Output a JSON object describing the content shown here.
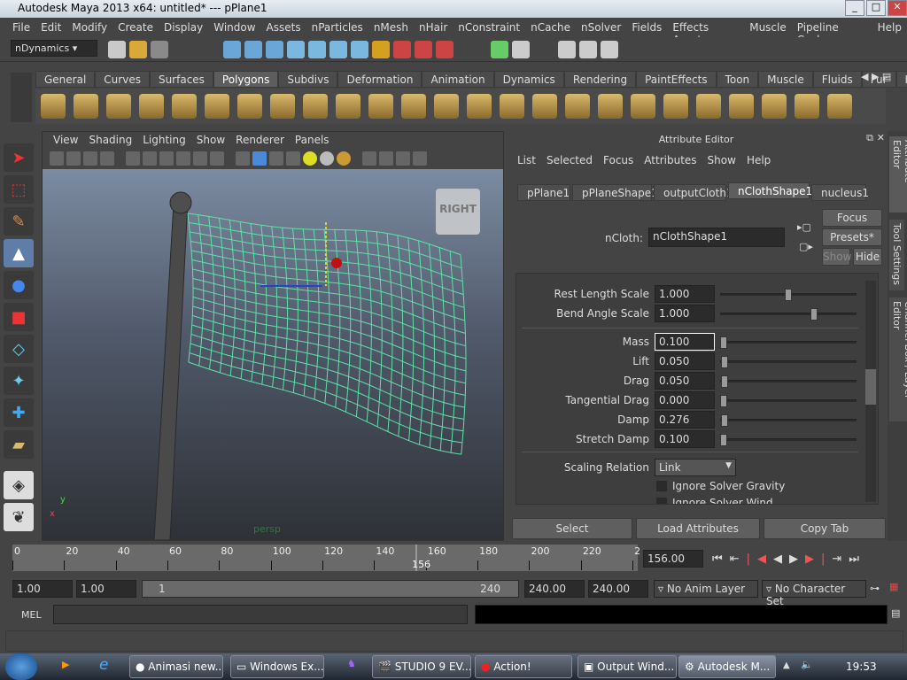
{
  "title": "Autodesk Maya 2013 x64: untitled*   ---   pPlane1",
  "menu": [
    "File",
    "Edit",
    "Modify",
    "Create",
    "Display",
    "Window",
    "Assets",
    "nParticles",
    "nMesh",
    "nHair",
    "nConstraint",
    "nCache",
    "nSolver",
    "Fields",
    "Effects Assets",
    "Muscle",
    "Pipeline Cache",
    "Help"
  ],
  "menuset": "nDynamics",
  "shelf_tabs": [
    "General",
    "Curves",
    "Surfaces",
    "Polygons",
    "Subdivs",
    "Deformation",
    "Animation",
    "Dynamics",
    "Rendering",
    "PaintEffects",
    "Toon",
    "Muscle",
    "Fluids",
    "Fur",
    "Hair"
  ],
  "shelf_active": "Polygons",
  "viewport": {
    "menu": [
      "View",
      "Shading",
      "Lighting",
      "Show",
      "Renderer",
      "Panels"
    ],
    "camera_label": "persp",
    "viewcube": "RIGHT",
    "axis_y": "y",
    "axis_x": "x"
  },
  "ae": {
    "title": "Attribute Editor",
    "menu": [
      "List",
      "Selected",
      "Focus",
      "Attributes",
      "Show",
      "Help"
    ],
    "tabs": [
      "pPlane1",
      "pPlaneShape1",
      "outputCloth1",
      "nClothShape1",
      "nucleus1"
    ],
    "active_tab": "nClothShape1",
    "node_label": "nCloth:",
    "node_value": "nClothShape1",
    "focus": "Focus",
    "presets": "Presets*",
    "show": "Show",
    "hide": "Hide",
    "attrs": [
      {
        "label": "Rest Length Scale",
        "value": "1.000",
        "slider": 0.5
      },
      {
        "label": "Bend Angle Scale",
        "value": "1.000",
        "slider": 0.7
      },
      {
        "label": "Mass",
        "value": "0.100",
        "slider": 0.0
      },
      {
        "label": "Lift",
        "value": "0.050",
        "slider": 0.01
      },
      {
        "label": "Drag",
        "value": "0.050",
        "slider": 0.01
      },
      {
        "label": "Tangential Drag",
        "value": "0.000",
        "slider": 0.0
      },
      {
        "label": "Damp",
        "value": "0.276",
        "slider": 0.01
      },
      {
        "label": "Stretch Damp",
        "value": "0.100",
        "slider": 0.0
      }
    ],
    "scaling_label": "Scaling Relation",
    "scaling_value": "Link",
    "ignore_gravity": "Ignore Solver Gravity",
    "ignore_wind": "Ignore Solver Wind",
    "select": "Select",
    "load": "Load Attributes",
    "copy": "Copy Tab"
  },
  "right_tabs": [
    "Attribute Editor",
    "Tool Settings",
    "Channel Box / Layer Editor"
  ],
  "timeline": {
    "ticks": [
      "0",
      "20",
      "40",
      "60",
      "80",
      "100",
      "120",
      "140",
      "160",
      "180",
      "200",
      "220",
      "2"
    ],
    "current": "156",
    "current_field": "156.00"
  },
  "range": {
    "start": "1.00",
    "start2": "1.00",
    "slider_start": "1",
    "slider_end": "240",
    "end": "240.00",
    "end2": "240.00",
    "anim_layer": "No Anim Layer",
    "char_set": "No Character Set"
  },
  "mel": "MEL",
  "taskbar": {
    "items": [
      "Animasi new...",
      "Windows Ex...",
      "STUDIO 9 EV...",
      "Action!",
      "Output Wind...",
      "Autodesk M..."
    ],
    "clock": "19:53"
  }
}
